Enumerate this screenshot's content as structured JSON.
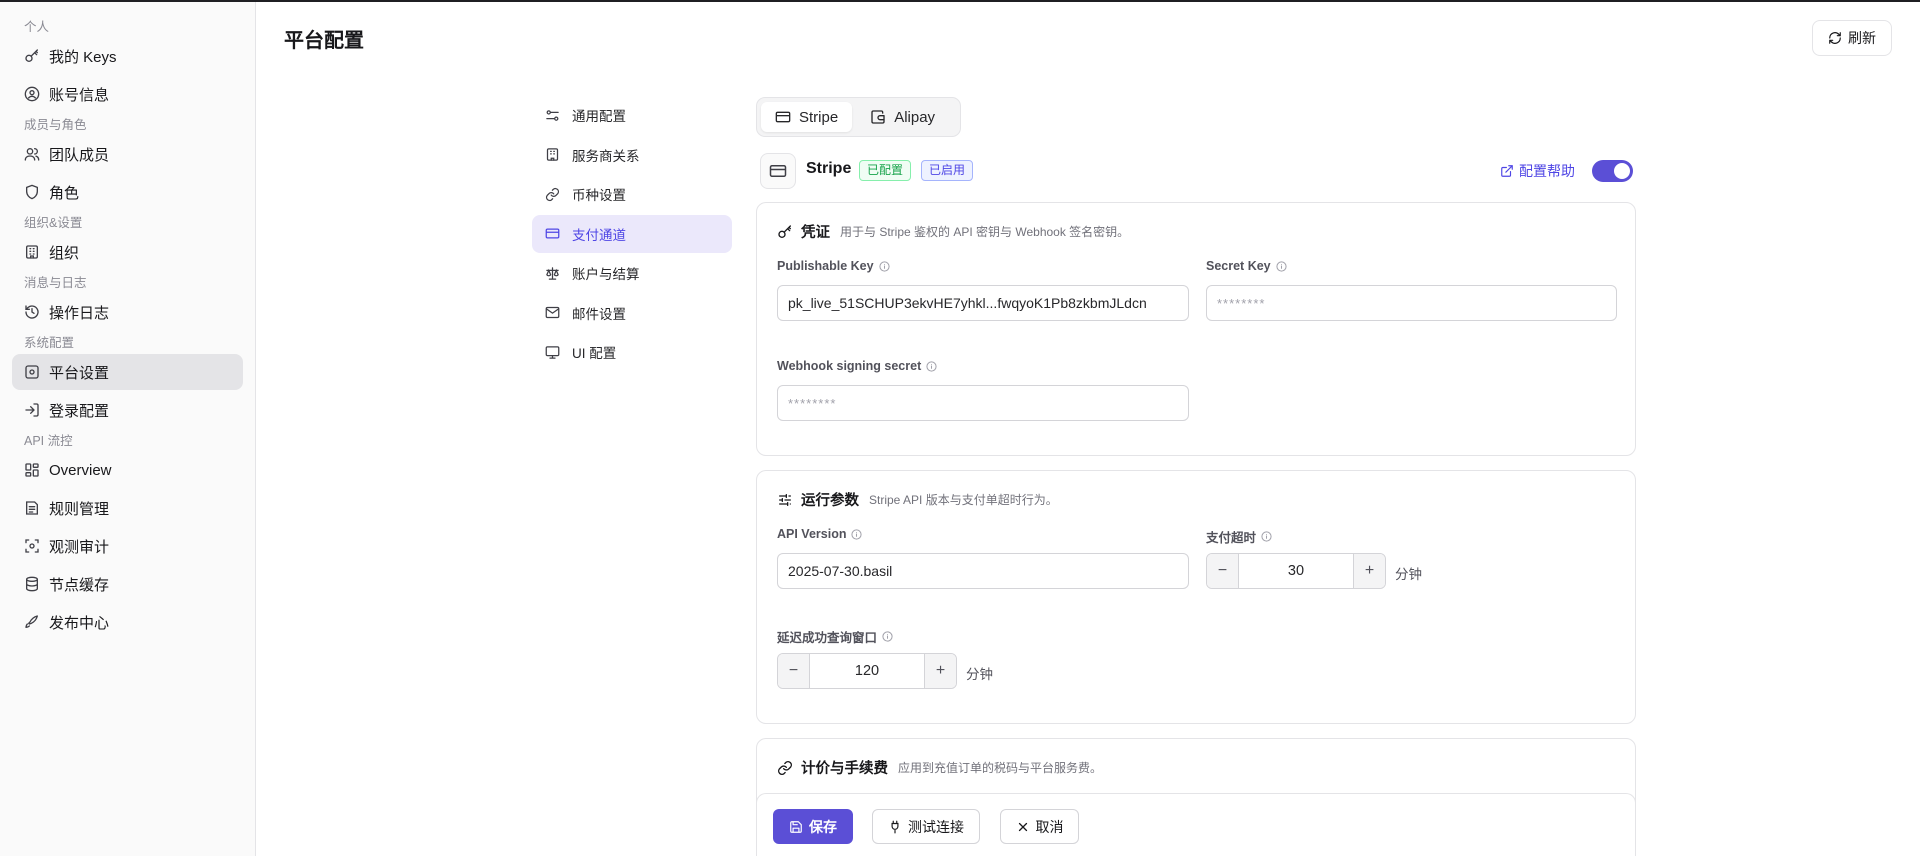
{
  "sidebar": {
    "groups": [
      {
        "label": "个人",
        "items": [
          {
            "label": "我的 Keys",
            "icon": "key-icon"
          },
          {
            "label": "账号信息",
            "icon": "user-circle-icon"
          }
        ]
      },
      {
        "label": "成员与角色",
        "items": [
          {
            "label": "团队成员",
            "icon": "users-icon"
          },
          {
            "label": "角色",
            "icon": "shield-icon"
          }
        ]
      },
      {
        "label": "组织&设置",
        "items": [
          {
            "label": "组织",
            "icon": "building-icon"
          }
        ]
      },
      {
        "label": "消息与日志",
        "items": [
          {
            "label": "操作日志",
            "icon": "history-icon"
          }
        ]
      },
      {
        "label": "系统配置",
        "items": [
          {
            "label": "平台设置",
            "icon": "settings-icon",
            "active": true
          },
          {
            "label": "登录配置",
            "icon": "login-icon"
          }
        ]
      },
      {
        "label": "API 流控",
        "items": [
          {
            "label": "Overview",
            "icon": "grid-icon"
          },
          {
            "label": "规则管理",
            "icon": "rules-icon"
          },
          {
            "label": "观测审计",
            "icon": "scan-icon"
          },
          {
            "label": "节点缓存",
            "icon": "database-icon"
          },
          {
            "label": "发布中心",
            "icon": "rocket-icon"
          }
        ]
      }
    ]
  },
  "header": {
    "title": "平台配置",
    "refresh_label": "刷新"
  },
  "subnav": {
    "items": [
      {
        "label": "通用配置",
        "icon": "sliders-icon"
      },
      {
        "label": "服务商关系",
        "icon": "building-icon"
      },
      {
        "label": "币种设置",
        "icon": "link-icon"
      },
      {
        "label": "支付通道",
        "icon": "credit-card-icon",
        "active": true
      },
      {
        "label": "账户与结算",
        "icon": "scale-icon"
      },
      {
        "label": "邮件设置",
        "icon": "mail-icon"
      },
      {
        "label": "UI 配置",
        "icon": "monitor-icon"
      }
    ]
  },
  "tabs": {
    "stripe": "Stripe",
    "alipay": "Alipay",
    "active": "stripe"
  },
  "provider": {
    "name": "Stripe",
    "badge_configured": "已配置",
    "badge_enabled": "已启用",
    "help_label": "配置帮助",
    "enabled": true
  },
  "credentials": {
    "title": "凭证",
    "description": "用于与 Stripe 鉴权的 API 密钥与 Webhook 签名密钥。",
    "publishable_key_label": "Publishable Key",
    "publishable_key_value": "pk_live_51SCHUP3ekvHE7yhkl...fwqyoK1Pb8zkbmJLdcn",
    "secret_key_label": "Secret Key",
    "secret_key_placeholder": "********",
    "webhook_label": "Webhook signing secret",
    "webhook_placeholder": "********"
  },
  "runtime": {
    "title": "运行参数",
    "description": "Stripe API 版本与支付单超时行为。",
    "api_version_label": "API Version",
    "api_version_value": "2025-07-30.basil",
    "timeout_label": "支付超时",
    "timeout_value": "30",
    "timeout_unit": "分钟",
    "delay_label": "延迟成功查询窗口",
    "delay_value": "120",
    "delay_unit": "分钟"
  },
  "pricing": {
    "title": "计价与手续费",
    "description": "应用到充值订单的税码与平台服务费。"
  },
  "footer": {
    "save_label": "保存",
    "test_label": "测试连接",
    "cancel_label": "取消"
  },
  "colors": {
    "accent": "#5b4fd6",
    "accent_light": "#ebe8fb",
    "success": "#16a34a"
  }
}
